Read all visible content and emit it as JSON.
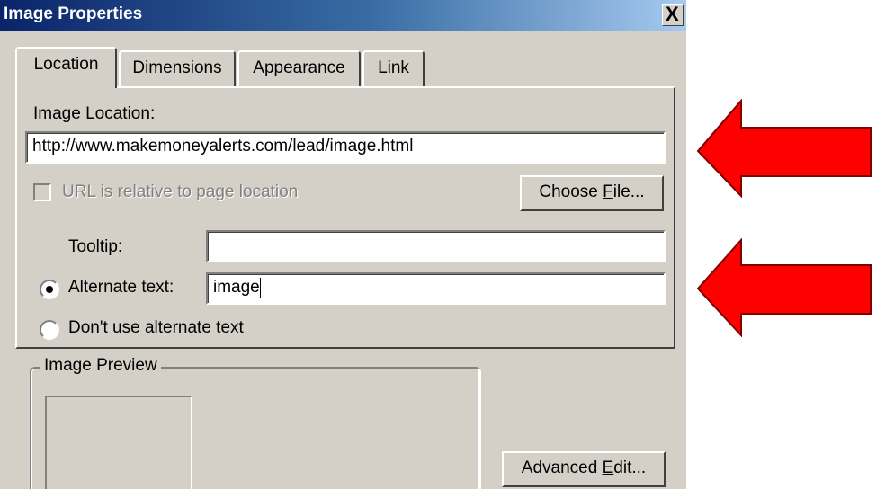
{
  "window": {
    "title": "Image Properties",
    "close_glyph": "X"
  },
  "tabs": [
    {
      "label": "Location",
      "active": true
    },
    {
      "label": "Dimensions",
      "active": false
    },
    {
      "label": "Appearance",
      "active": false
    },
    {
      "label": "Link",
      "active": false
    }
  ],
  "location": {
    "image_location_label_pre": "Image ",
    "image_location_label_key": "L",
    "image_location_label_post": "ocation:",
    "url_value": "http://www.makemoneyalerts.com/lead/image.html",
    "relative_checkbox_label": "URL is relative to page location",
    "relative_checkbox_checked": false,
    "relative_checkbox_enabled": false,
    "choose_file_pre": "Choose ",
    "choose_file_key": "F",
    "choose_file_post": "ile...",
    "tooltip_label_key": "T",
    "tooltip_label_post": "ooltip:",
    "tooltip_value": "",
    "alt_radio_label": "Alternate text:",
    "alt_radio_selected": true,
    "alt_value": "image",
    "no_alt_radio_label": "Don't use alternate text",
    "no_alt_radio_selected": false
  },
  "preview": {
    "legend": "Image Preview"
  },
  "advanced_edit": {
    "pre": "Advanced ",
    "key": "E",
    "post": "dit..."
  },
  "colors": {
    "dialog_bg": "#d4d0c8",
    "title_start": "#0a246a",
    "title_end": "#a6caf0",
    "arrow": "#ff0000"
  },
  "icons": {
    "close": "close-icon",
    "arrow": "left-arrow-icon"
  }
}
